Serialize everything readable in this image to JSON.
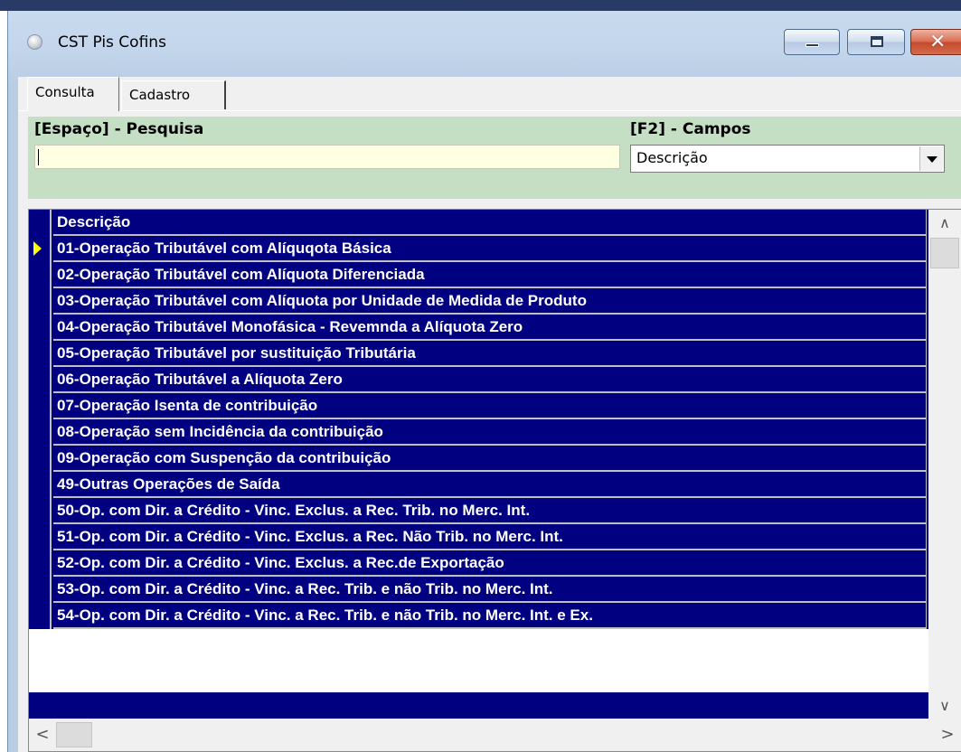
{
  "window": {
    "title": "CST Pis Cofins",
    "icon": "app-icon"
  },
  "tabs": [
    {
      "label": "Consulta",
      "active": true
    },
    {
      "label": "Cadastro",
      "active": false
    }
  ],
  "filter": {
    "search_label": "[Espaço] - Pesquisa",
    "search_value": "",
    "fields_label": "[F2] - Campos",
    "fields_selected": "Descrição"
  },
  "grid": {
    "header": "Descrição",
    "current_row": 0,
    "rows": [
      "01-Operação Tributável com Alíquqota Básica",
      "02-Operação Tributável com Alíquota Diferenciada",
      "03-Operação Tributável com Alíquota por Unidade de Medida de Produto",
      "04-Operação Tributável Monofásica - Revemnda a Alíquota Zero",
      "05-Operação Tributável por sustituição Tributária",
      "06-Operação Tributável a Alíquota Zero",
      "07-Operação Isenta de contribuição",
      "08-Operação sem Incidência da contribuição",
      "09-Operação com Suspenção da contribuição",
      "49-Outras Operações de Saída",
      "50-Op. com Dir. a Crédito - Vinc. Exclus. a Rec. Trib. no Merc. Int.",
      "51-Op. com Dir. a Crédito - Vinc. Exclus. a Rec. Não Trib. no Merc. Int.",
      "52-Op. com Dir. a Crédito - Vinc. Exclus. a Rec.de Exportação",
      "53-Op. com Dir. a Crédito - Vinc. a Rec. Trib. e não Trib. no Merc. Int.",
      "54-Op. com Dir. a Crédito - Vinc. a Rec. Trib. e não Trib. no Merc. Int. e Ex."
    ]
  },
  "colors": {
    "row_background": "#000080",
    "filter_panel": "#c4dfc3",
    "search_background": "#ffffe1",
    "current_row_indicator": "#ffff00"
  }
}
